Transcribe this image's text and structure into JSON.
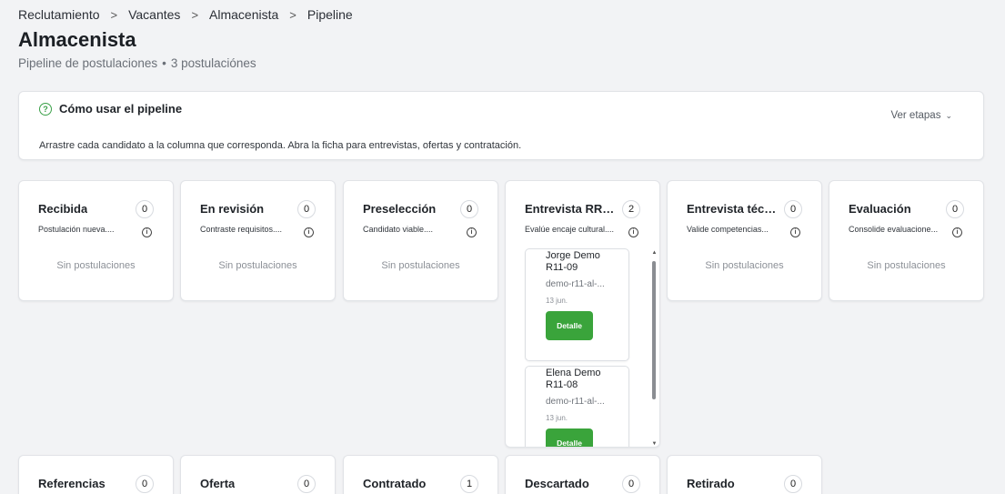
{
  "breadcrumb": [
    "Reclutamiento",
    "Vacantes",
    "Almacenista",
    "Pipeline"
  ],
  "breadcrumb_sep": ">",
  "page": {
    "title": "Almacenista",
    "subtitle_main": "Pipeline de postulaciones",
    "subtitle_dot": "•",
    "subtitle_count": "3 postulaciónes"
  },
  "help": {
    "icon": "question-circle-icon",
    "icon_glyph": "?",
    "title": "Cómo usar el pipeline",
    "toggle_label": "Ver etapas",
    "toggle_chevron": "⌄",
    "text": "Arrastre cada candidato a la columna que corresponda. Abra la ficha para entrevistas, ofertas y contratación."
  },
  "info_glyph": "i",
  "empty_label": "Sin postulaciones",
  "columns_row1": [
    {
      "title": "Recibida",
      "count": "0",
      "desc": "Postulación nueva...."
    },
    {
      "title": "En revisión",
      "count": "0",
      "desc": "Contraste requisitos...."
    },
    {
      "title": "Preselección",
      "count": "0",
      "desc": "Candidato viable...."
    },
    {
      "title": "Entrevista RRHH",
      "count": "2",
      "desc": "Evalúe encaje cultural...."
    },
    {
      "title": "Entrevista técn...",
      "count": "0",
      "desc": "Valide competencias..."
    },
    {
      "title": "Evaluación",
      "count": "0",
      "desc": "Consolide evaluacione..."
    }
  ],
  "candidates": [
    {
      "name": "Jorge Demo R11-09",
      "code": "demo-r11-al-...",
      "date": "13 jun.",
      "button": "Detalle"
    },
    {
      "name": "Elena Demo R11-08",
      "code": "demo-r11-al-...",
      "date": "13 jun.",
      "button": "Detalle"
    }
  ],
  "scroll": {
    "up": "▲",
    "down": "▼"
  },
  "columns_row2": [
    {
      "title": "Referencias",
      "count": "0"
    },
    {
      "title": "Oferta",
      "count": "0"
    },
    {
      "title": "Contratado",
      "count": "1"
    },
    {
      "title": "Descartado",
      "count": "0"
    },
    {
      "title": "Retirado",
      "count": "0"
    }
  ]
}
